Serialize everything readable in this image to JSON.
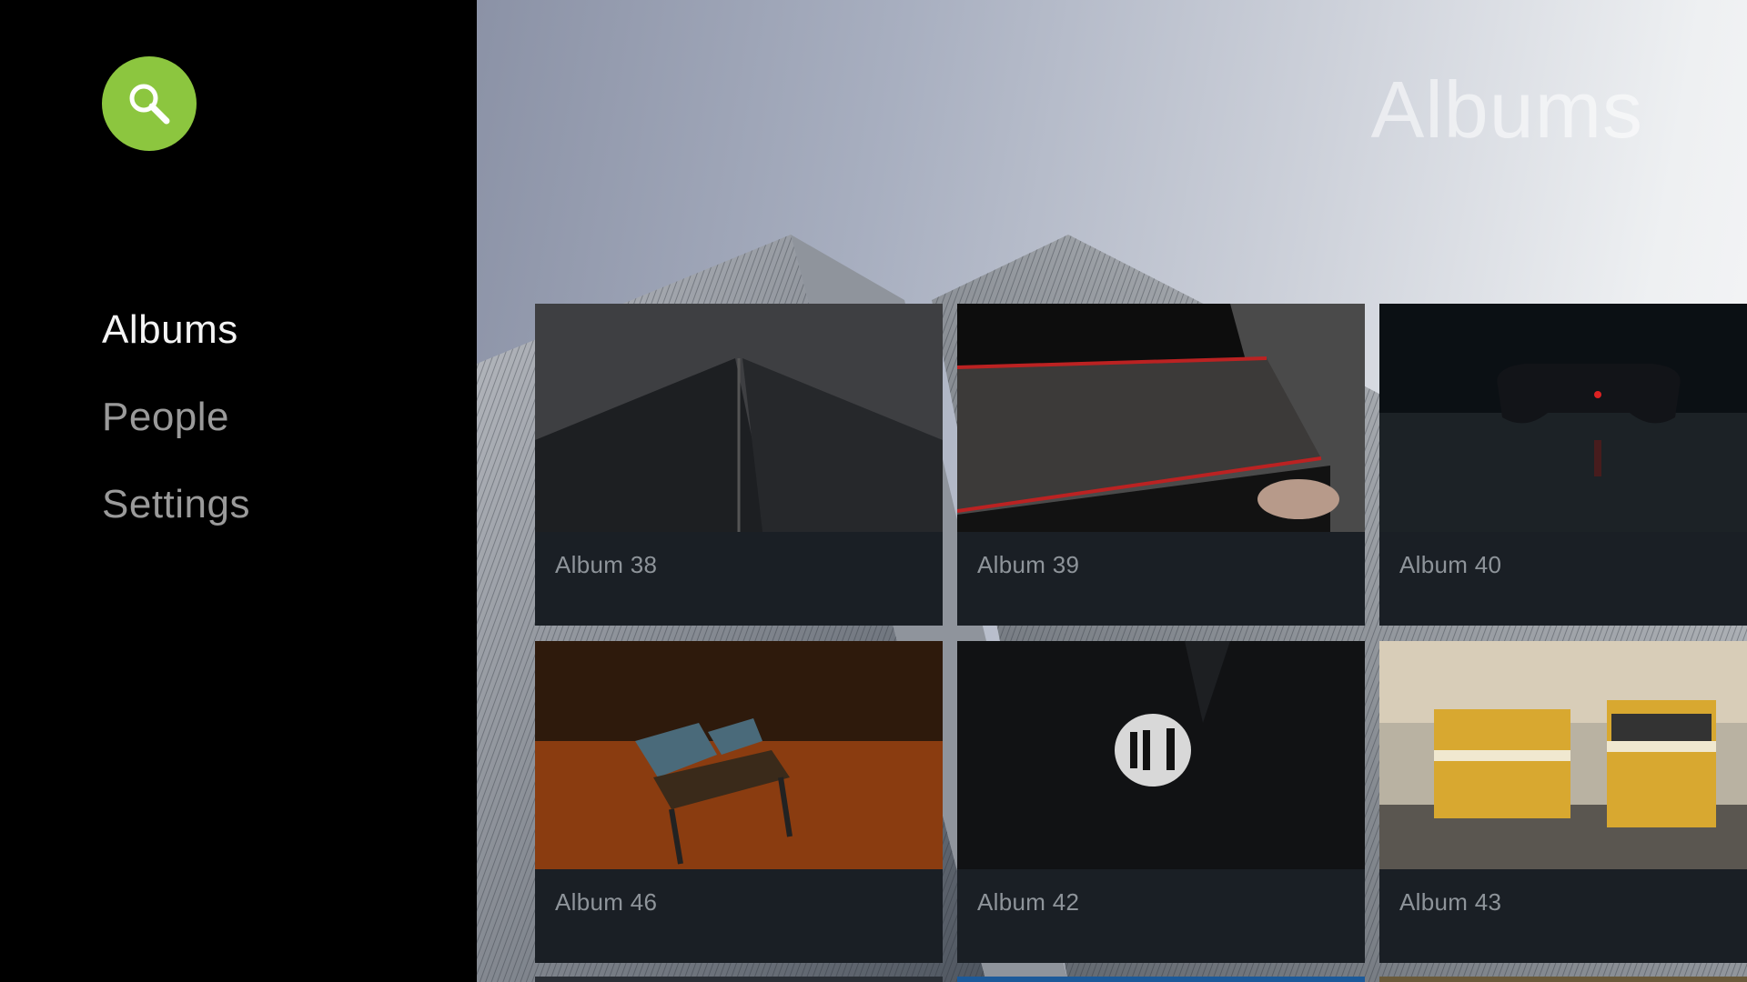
{
  "sidebar": {
    "search_icon": "search-icon",
    "accent_color": "#8cc63f",
    "items": [
      {
        "label": "Albums",
        "active": true
      },
      {
        "label": "People",
        "active": false
      },
      {
        "label": "Settings",
        "active": false
      }
    ]
  },
  "main": {
    "title": "Albums",
    "albums": [
      {
        "label": "Album 38"
      },
      {
        "label": "Album 39"
      },
      {
        "label": "Album 40"
      },
      {
        "label": "Album 46"
      },
      {
        "label": "Album 42"
      },
      {
        "label": "Album 43"
      }
    ]
  }
}
